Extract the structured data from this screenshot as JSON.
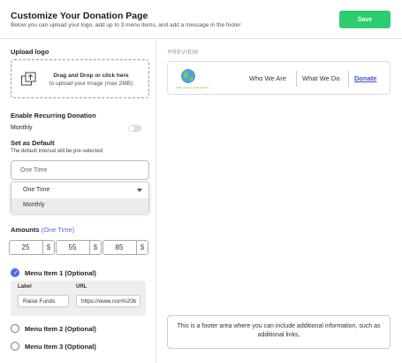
{
  "header": {
    "title": "Customize Your Donation Page",
    "subtitle": "Below you can upload your logo, add up to 3 menu items, and add a message in the footer",
    "save_label": "Save"
  },
  "upload": {
    "section_label": "Upload logo",
    "line1": "Drag and Drop or click here",
    "line2": "to upload your image (max 2MB)"
  },
  "recurring": {
    "section_label": "Enable Recurring Donation",
    "toggle_label": "Monthly",
    "toggle_on": false
  },
  "default_interval": {
    "section_label": "Set as Default",
    "hint": "The default interval will be pre-selected",
    "input_value": "One Time",
    "dropdown_selected": "One Time",
    "dropdown_options": [
      "Monthly"
    ]
  },
  "amounts": {
    "label": "Amounts",
    "label_suffix": "(One Time)",
    "items": [
      {
        "value": "25",
        "currency": "$"
      },
      {
        "value": "55",
        "currency": "$"
      },
      {
        "value": "85",
        "currency": "$"
      }
    ]
  },
  "menu_items": [
    {
      "label": "Menu Item 1 (Optional)",
      "checked": true
    },
    {
      "label": "Menu Item 2 (Optional)",
      "checked": false
    },
    {
      "label": "Menu Item 3 (Optional)",
      "checked": false
    }
  ],
  "menu_item_1": {
    "label_header": "Label",
    "url_header": "URL",
    "label_value": "Raise Funds",
    "url_value": "https://www.non%20b"
  },
  "preview": {
    "label": "PREVIEW",
    "logo_text": "LIVE LAUGH LOVE EARTH",
    "nav": [
      "Who We Are",
      "What We Do",
      "Donate"
    ],
    "footer_text": "This is a footer area where you can include additional information, such as additional links,"
  },
  "colors": {
    "save_button": "#2ecc71",
    "accent": "#4a6cf7",
    "link": "#3b4fd8"
  }
}
